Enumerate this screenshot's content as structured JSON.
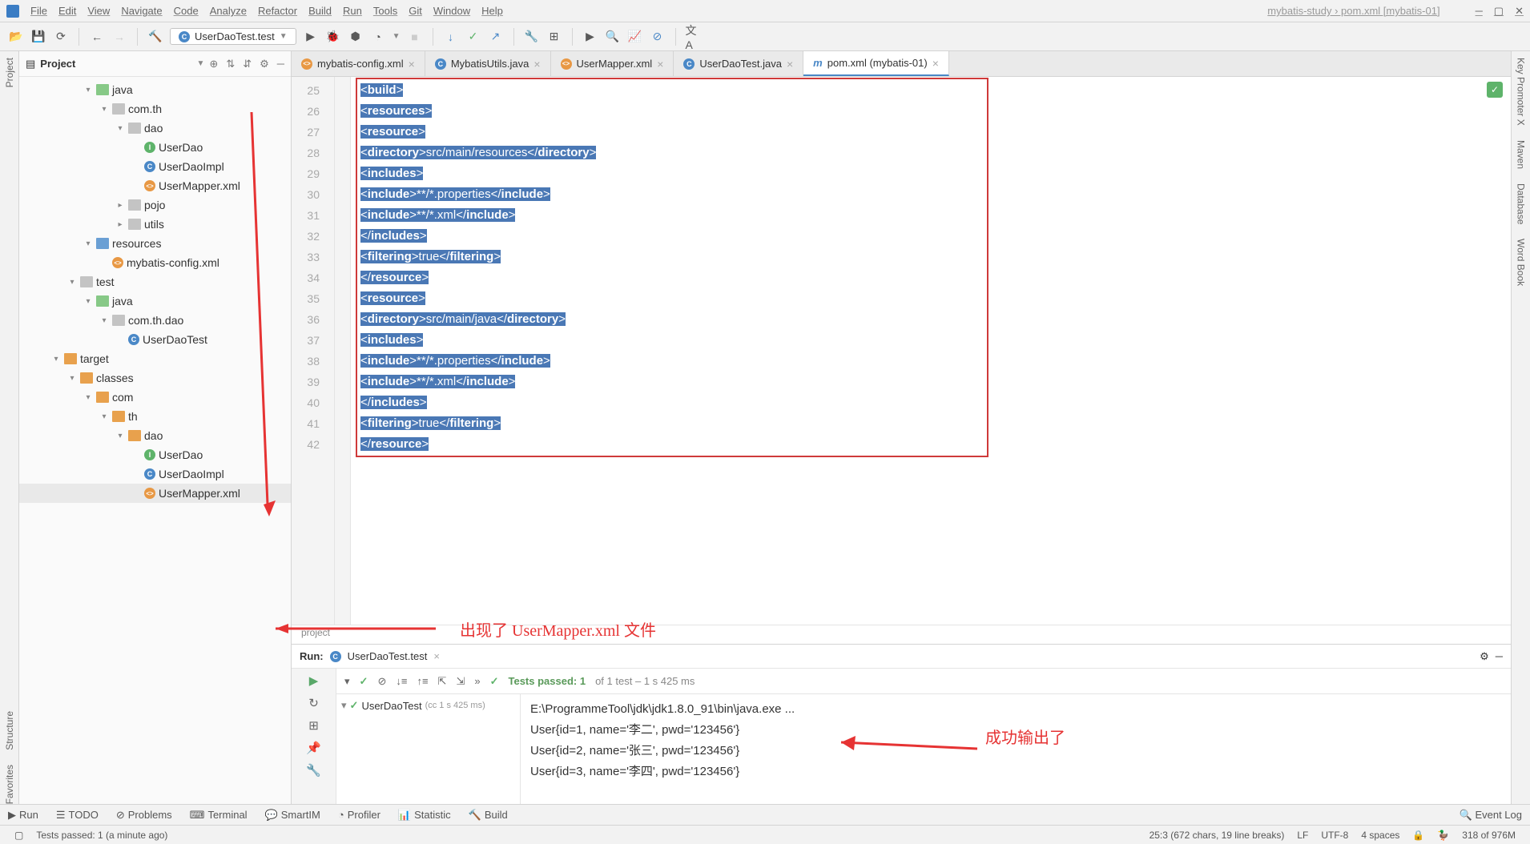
{
  "menu": {
    "items": [
      "File",
      "Edit",
      "View",
      "Navigate",
      "Code",
      "Analyze",
      "Refactor",
      "Build",
      "Run",
      "Tools",
      "Git",
      "Window",
      "Help"
    ],
    "path": "mybatis-study › pom.xml [mybatis-01]"
  },
  "toolbar": {
    "run_config": "UserDaoTest.test"
  },
  "project": {
    "title": "Project",
    "tree": [
      {
        "indent": 4,
        "exp": "▾",
        "icon": "folder-green",
        "label": "java"
      },
      {
        "indent": 5,
        "exp": "▾",
        "icon": "folder-gray",
        "label": "com.th"
      },
      {
        "indent": 6,
        "exp": "▾",
        "icon": "folder-gray",
        "label": "dao"
      },
      {
        "indent": 7,
        "exp": "",
        "icon": "interface",
        "label": "UserDao"
      },
      {
        "indent": 7,
        "exp": "",
        "icon": "class",
        "label": "UserDaoImpl"
      },
      {
        "indent": 7,
        "exp": "",
        "icon": "xml",
        "label": "UserMapper.xml"
      },
      {
        "indent": 6,
        "exp": "▸",
        "icon": "folder-gray",
        "label": "pojo"
      },
      {
        "indent": 6,
        "exp": "▸",
        "icon": "folder-gray",
        "label": "utils"
      },
      {
        "indent": 4,
        "exp": "▾",
        "icon": "folder-blue",
        "label": "resources"
      },
      {
        "indent": 5,
        "exp": "",
        "icon": "xml",
        "label": "mybatis-config.xml"
      },
      {
        "indent": 3,
        "exp": "▾",
        "icon": "folder-gray",
        "label": "test"
      },
      {
        "indent": 4,
        "exp": "▾",
        "icon": "folder-green",
        "label": "java"
      },
      {
        "indent": 5,
        "exp": "▾",
        "icon": "folder-gray",
        "label": "com.th.dao"
      },
      {
        "indent": 6,
        "exp": "",
        "icon": "class",
        "label": "UserDaoTest"
      },
      {
        "indent": 2,
        "exp": "▾",
        "icon": "folder-orange",
        "label": "target"
      },
      {
        "indent": 3,
        "exp": "▾",
        "icon": "folder-orange",
        "label": "classes"
      },
      {
        "indent": 4,
        "exp": "▾",
        "icon": "folder-orange",
        "label": "com"
      },
      {
        "indent": 5,
        "exp": "▾",
        "icon": "folder-orange",
        "label": "th"
      },
      {
        "indent": 6,
        "exp": "▾",
        "icon": "folder-orange",
        "label": "dao"
      },
      {
        "indent": 7,
        "exp": "",
        "icon": "interface",
        "label": "UserDao"
      },
      {
        "indent": 7,
        "exp": "",
        "icon": "class",
        "label": "UserDaoImpl"
      },
      {
        "indent": 7,
        "exp": "",
        "icon": "xml",
        "label": "UserMapper.xml",
        "hl": true
      }
    ]
  },
  "tabs": [
    {
      "icon": "xml",
      "label": "mybatis-config.xml",
      "active": false
    },
    {
      "icon": "class",
      "label": "MybatisUtils.java",
      "active": false
    },
    {
      "icon": "xml",
      "label": "UserMapper.xml",
      "active": false
    },
    {
      "icon": "class",
      "label": "UserDaoTest.java",
      "active": false
    },
    {
      "icon": "m",
      "label": "pom.xml (mybatis-01)",
      "active": true
    }
  ],
  "gutter": {
    "start": 25,
    "end": 42
  },
  "code_lines": [
    "<build>",
    "    <resources>",
    "        <resource>",
    "            <directory>src/main/resources</directory>",
    "            <includes>",
    "                <include>**/*.properties</include>",
    "                <include>**/*.xml</include>",
    "            </includes>",
    "            <filtering>true</filtering>",
    "        </resource>",
    "        <resource>",
    "            <directory>src/main/java</directory>",
    "            <includes>",
    "                <include>**/*.properties</include>",
    "                <include>**/*.xml</include>",
    "            </includes>",
    "            <filtering>true</filtering>",
    "        </resource>"
  ],
  "breadcrumb": "project",
  "run": {
    "title": "Run:",
    "config": "UserDaoTest.test",
    "tests_passed": "Tests passed: 1",
    "tests_rest": " of 1 test – 1 s 425 ms",
    "tree_root": "UserDaoTest",
    "tree_time": "(cc 1 s 425 ms)",
    "console": [
      "E:\\ProgrammeTool\\jdk\\jdk1.8.0_91\\bin\\java.exe ...",
      "User{id=1, name='李二', pwd='123456'}",
      "User{id=2, name='张三', pwd='123456'}",
      "User{id=3, name='李四', pwd='123456'}"
    ]
  },
  "annotations": {
    "ann1": "出现了 UserMapper.xml 文件",
    "ann2": "成功输出了"
  },
  "bottom_tabs": [
    "Run",
    "TODO",
    "Problems",
    "Terminal",
    "SmartIM",
    "Profiler",
    "Statistic",
    "Build"
  ],
  "event_log": "Event Log",
  "status": {
    "left": "Tests passed: 1 (a minute ago)",
    "caret": "25:3 (672 chars, 19 line breaks)",
    "le": "LF",
    "enc": "UTF-8",
    "spaces": "4 spaces",
    "mem": "318 of 976M"
  },
  "rails": {
    "left": [
      "Project",
      "Structure",
      "Favorites"
    ],
    "right": [
      "Key Promoter X",
      "Maven",
      "Database",
      "Word Book"
    ]
  }
}
